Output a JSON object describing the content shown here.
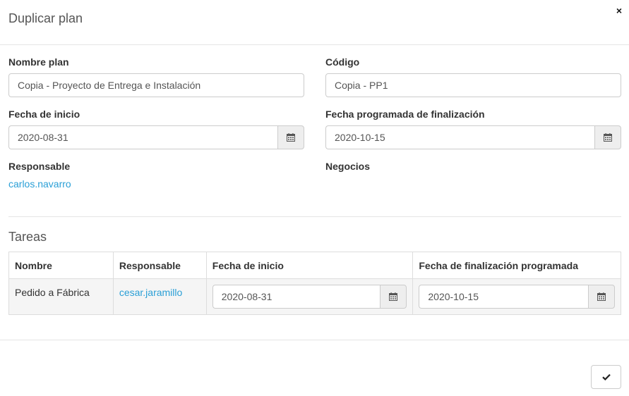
{
  "modal": {
    "title": "Duplicar plan",
    "close_symbol": "×"
  },
  "form": {
    "plan_name": {
      "label": "Nombre plan",
      "value": "Copia - Proyecto de Entrega e Instalación"
    },
    "code": {
      "label": "Código",
      "value": "Copia - PP1"
    },
    "start_date": {
      "label": "Fecha de inicio",
      "value": "2020-08-31"
    },
    "end_date": {
      "label": "Fecha programada de finalización",
      "value": "2020-10-15"
    },
    "responsible": {
      "label": "Responsable",
      "value": "carlos.navarro"
    },
    "business": {
      "label": "Negocios"
    }
  },
  "tasks": {
    "title": "Tareas",
    "columns": [
      "Nombre",
      "Responsable",
      "Fecha de inicio",
      "Fecha de finalización programada"
    ],
    "rows": [
      {
        "name": "Pedido a Fábrica",
        "responsible": "cesar.jaramillo",
        "start": "2020-08-31",
        "end": "2020-10-15"
      }
    ]
  },
  "icons": {
    "calendar": "calendar-icon",
    "confirm": "check-icon",
    "close": "close-icon"
  },
  "colors": {
    "link": "#2a9fd6",
    "addon_bg": "#eeeeee",
    "row_bg": "#f5f5f5",
    "border": "#cccccc"
  }
}
